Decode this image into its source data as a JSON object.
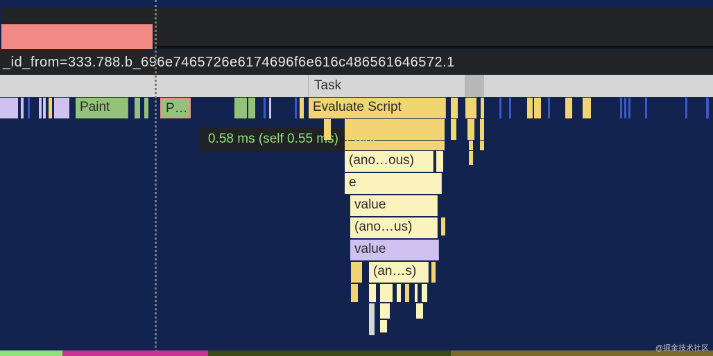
{
  "header": {
    "url_fragment": "_id_from=333.788.b_696e7465726e6174696f6e616c486561646572.1"
  },
  "tooltip": {
    "timing": "0.58 ms (self 0.55 ms)",
    "label": "Paint"
  },
  "flame": {
    "task": "Task",
    "paint": "Paint",
    "paint_abbrev": "P…",
    "evaluate_script": "Evaluate Script",
    "ano_ous": "(ano…ous)",
    "e": "e",
    "value1": "value",
    "ano_us": "(ano…us)",
    "value2": "value",
    "an_s": "(an…s)"
  },
  "watermark": "@掘金技术社区",
  "colors": {
    "paint": "#94c27a",
    "script": "#f0d572",
    "script_light": "#faf3bd",
    "layout": "#cfc2f1",
    "task": "#d6d6d6",
    "idle": "#12234f",
    "highlight_border": "#f18a84"
  }
}
